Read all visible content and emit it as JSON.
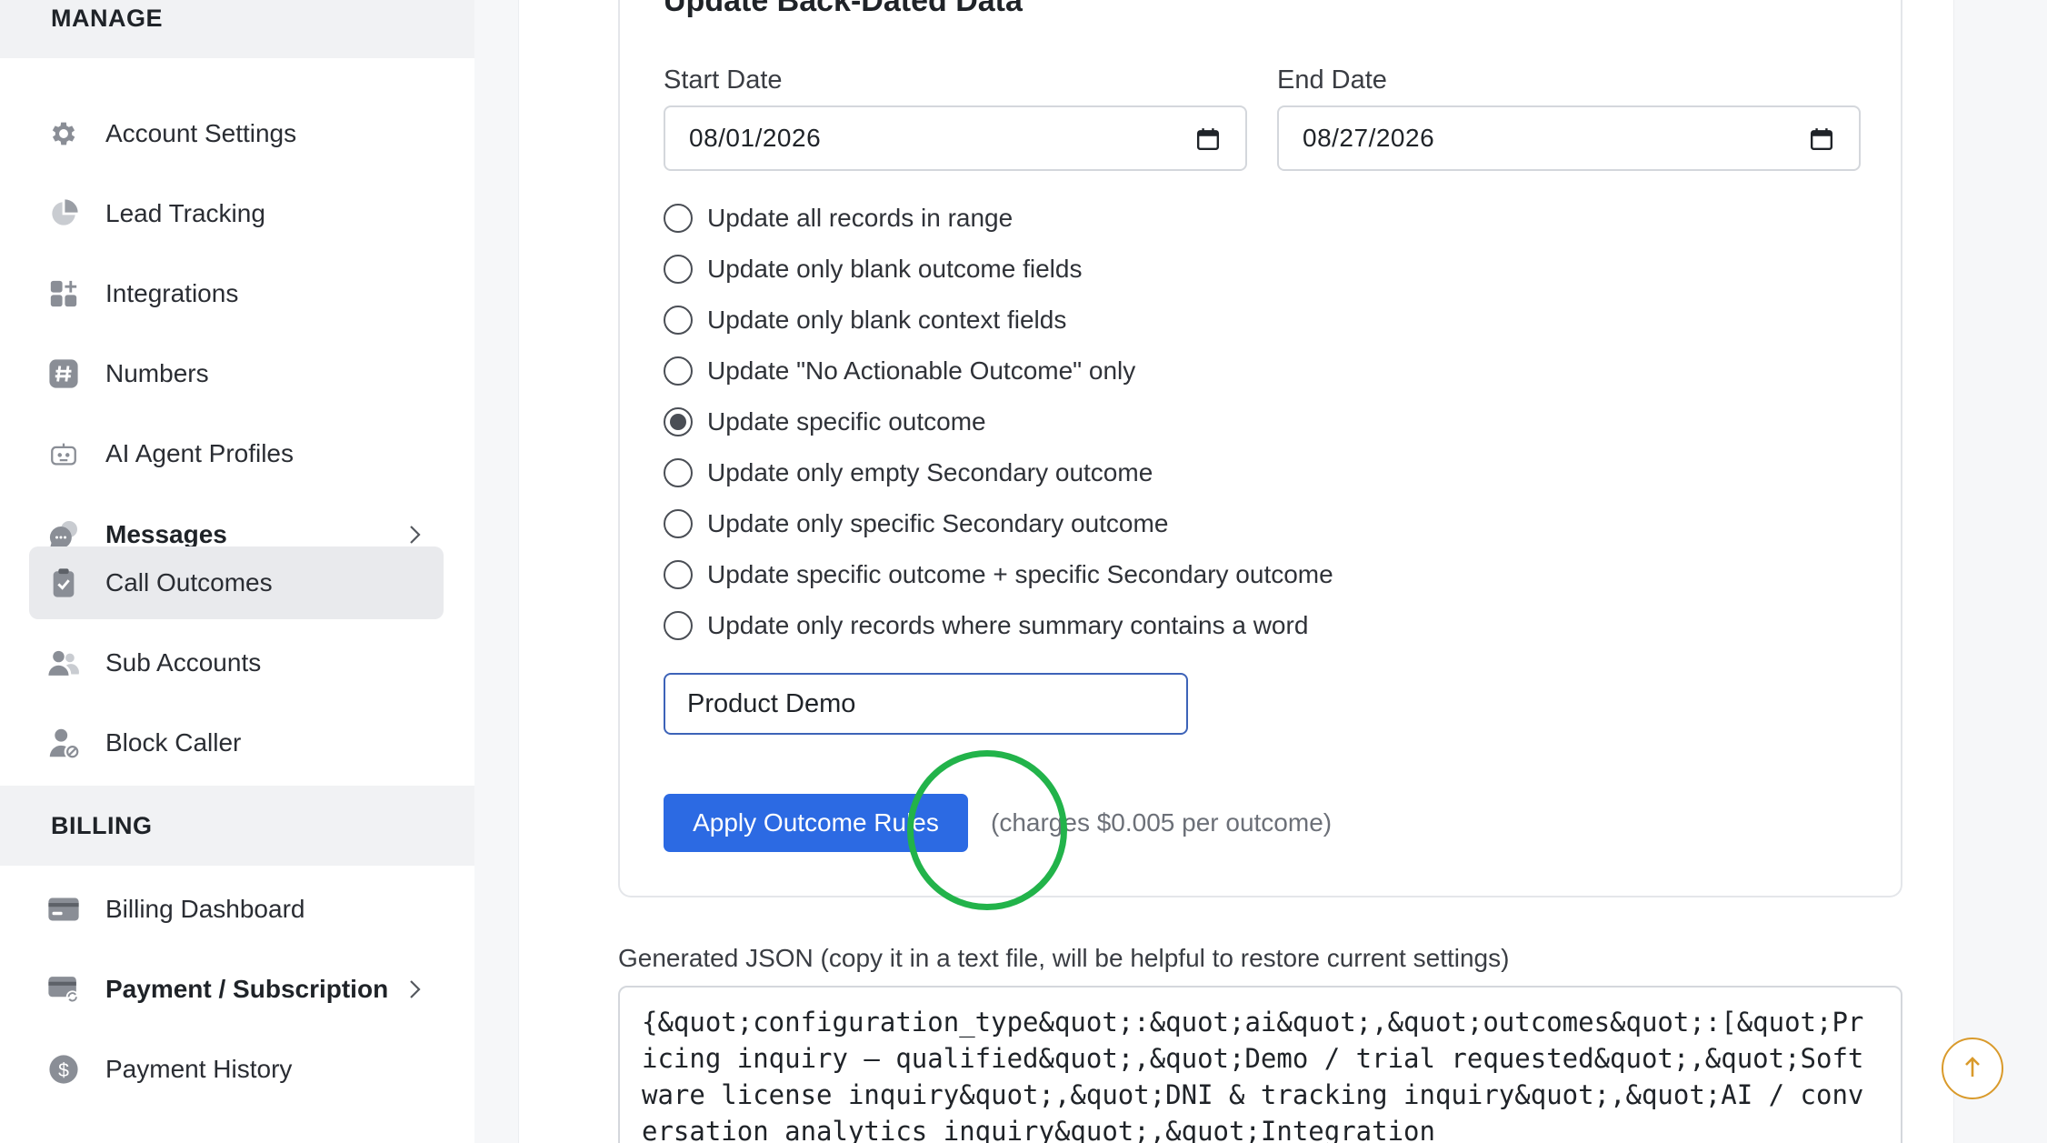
{
  "sidebar": {
    "manage_header": "MANAGE",
    "billing_header": "BILLING",
    "manage_items": [
      {
        "label": "Account Settings",
        "icon": "gear-icon"
      },
      {
        "label": "Lead Tracking",
        "icon": "pie-chart-icon"
      },
      {
        "label": "Integrations",
        "icon": "grid-plus-icon"
      },
      {
        "label": "Numbers",
        "icon": "hash-icon"
      },
      {
        "label": "AI Agent Profiles",
        "icon": "robot-icon"
      },
      {
        "label": "Messages",
        "icon": "chat-bubbles-icon"
      },
      {
        "label": "Call Outcomes",
        "icon": "clipboard-check-icon"
      },
      {
        "label": "Sub Accounts",
        "icon": "users-icon"
      },
      {
        "label": "Block Caller",
        "icon": "user-block-icon"
      }
    ],
    "billing_items": [
      {
        "label": "Billing Dashboard",
        "icon": "credit-card-icon"
      },
      {
        "label": "Payment / Subscription",
        "icon": "card-refresh-icon"
      },
      {
        "label": "Payment History",
        "icon": "dollar-circle-icon"
      }
    ],
    "active_item": "Call Outcomes"
  },
  "form": {
    "title": "Update Back-Dated Data",
    "start_date_label": "Start Date",
    "start_date_value": "08/01/2026",
    "end_date_label": "End Date",
    "end_date_value": "08/27/2026",
    "options": [
      "Update all records in range",
      "Update only blank outcome fields",
      "Update only blank context fields",
      "Update \"No Actionable Outcome\" only",
      "Update specific outcome",
      "Update only empty Secondary outcome",
      "Update only specific Secondary outcome",
      "Update specific outcome + specific Secondary outcome",
      "Update only records where summary contains a word"
    ],
    "selected_option": "Update specific outcome",
    "keyword_value": "Product Demo",
    "apply_button": "Apply Outcome Rules",
    "charge_note": "(charges $0.005 per outcome)"
  },
  "json_export": {
    "label": "Generated JSON (copy it in a text file, will be helpful to restore current settings)",
    "content": "{&quot;configuration_type&quot;:&quot;ai&quot;,&quot;outcomes&quot;:[&quot;Pricing inquiry – qualified&quot;,&quot;Demo / trial requested&quot;,&quot;Software license inquiry&quot;,&quot;DNI & tracking inquiry&quot;,&quot;AI / conversation analytics inquiry&quot;,&quot;Integration"
  },
  "colors": {
    "accent": "#2c6ae3",
    "active_bg": "#e9eaed",
    "click_ring": "#22b34a",
    "scroll_ring": "#d99a2b"
  },
  "scroll_top_icon": "arrow-up-icon"
}
